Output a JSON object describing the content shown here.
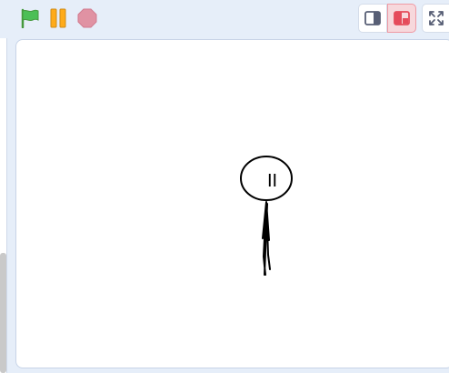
{
  "toolbar": {
    "green_flag_icon": "green-flag-icon",
    "pause_icon": "pause-icon",
    "stop_icon": "stop-sign-icon",
    "colors": {
      "flag": "#4cbf56",
      "pause": "#ffab19",
      "stop": "#e092a3",
      "mode_active_bg": "#f7d8dc",
      "mode_active_accent": "#e54a5a"
    }
  },
  "stage_modes": {
    "small_icon": "small-stage-icon",
    "large_icon": "large-stage-icon",
    "fullscreen_icon": "fullscreen-icon",
    "active": "large"
  },
  "stage": {
    "sprite_text": "II",
    "background": "#ffffff"
  }
}
